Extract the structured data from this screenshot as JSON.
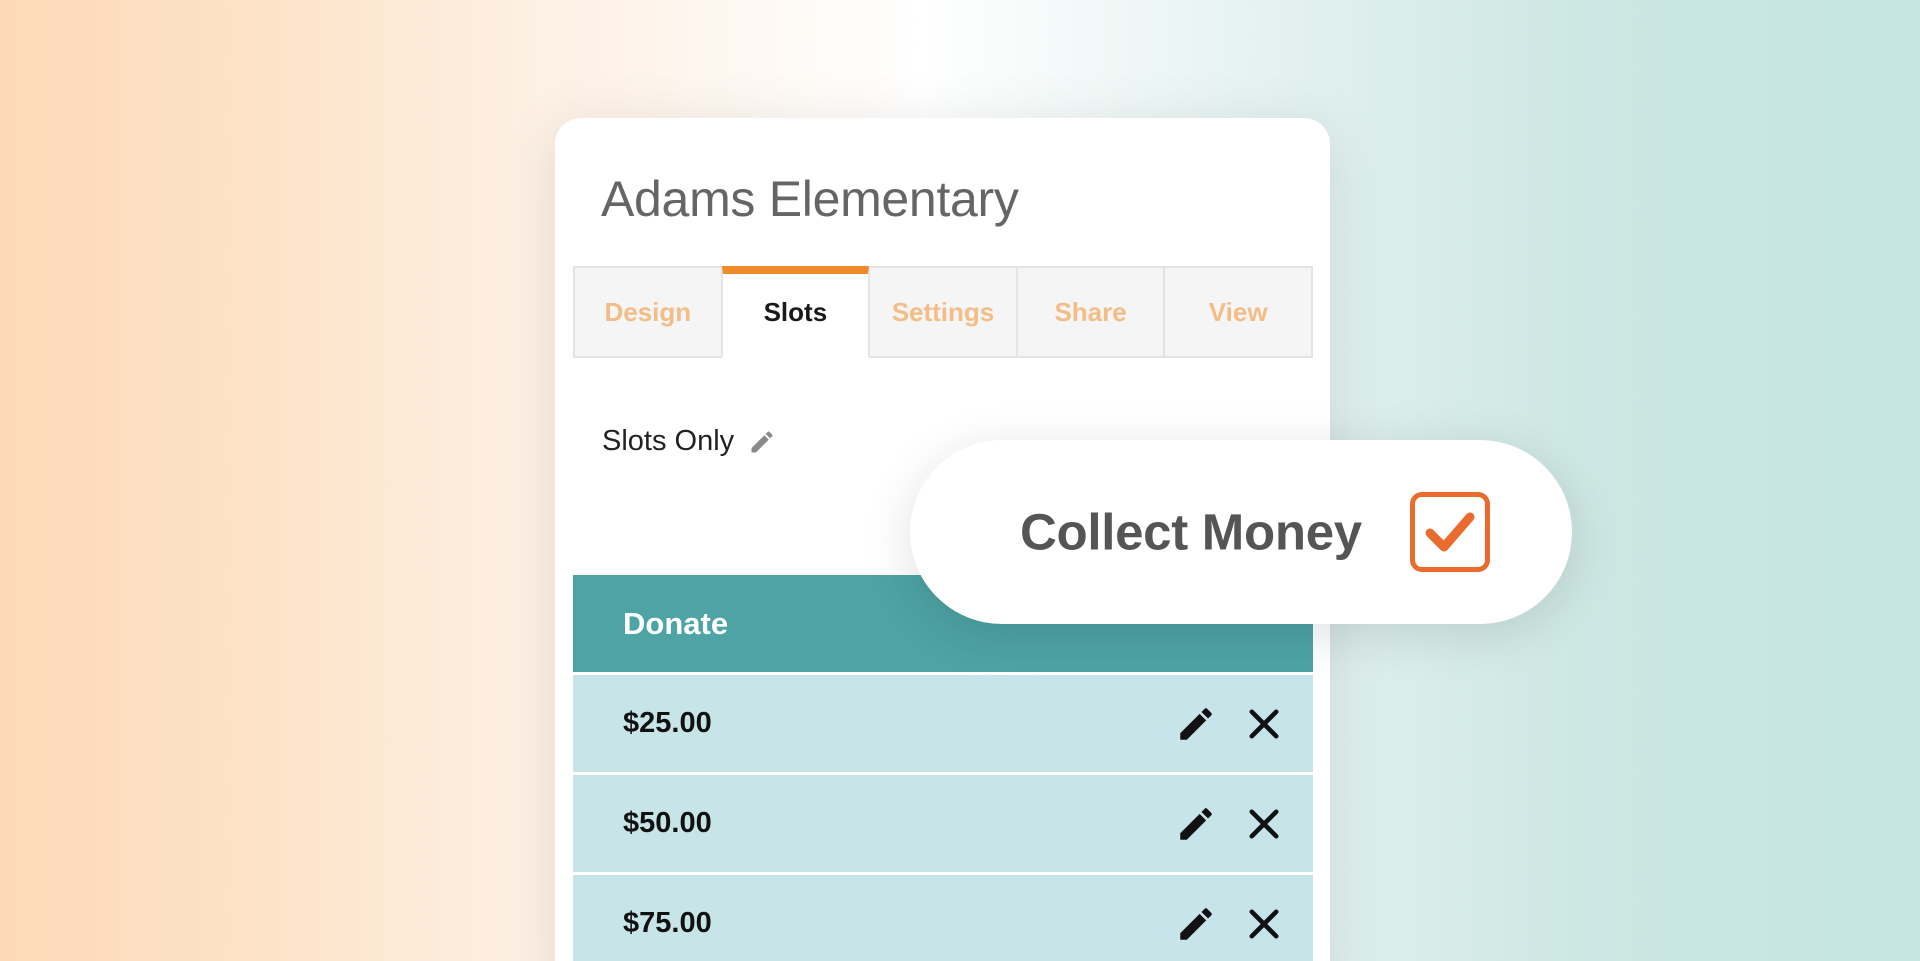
{
  "card": {
    "title": "Adams Elementary",
    "tabs": [
      {
        "label": "Design",
        "active": false
      },
      {
        "label": "Slots",
        "active": true
      },
      {
        "label": "Settings",
        "active": false
      },
      {
        "label": "Share",
        "active": false
      },
      {
        "label": "View",
        "active": false
      }
    ],
    "slots_mode_label": "Slots Only",
    "table": {
      "header": "Donate",
      "rows": [
        {
          "amount": "$25.00"
        },
        {
          "amount": "$50.00"
        },
        {
          "amount": "$75.00"
        }
      ]
    }
  },
  "collect_money": {
    "label": "Collect Money",
    "checked": true
  },
  "colors": {
    "accent_orange": "#f08a2a",
    "inactive_tab_text": "#f4bd86",
    "table_header_teal": "#4ea3a5",
    "row_light_blue": "#c7e4e9",
    "checkbox_orange": "#ea6b2e"
  },
  "icons": {
    "edit": "pencil-icon",
    "delete": "close-icon",
    "checkbox": "check-icon"
  }
}
